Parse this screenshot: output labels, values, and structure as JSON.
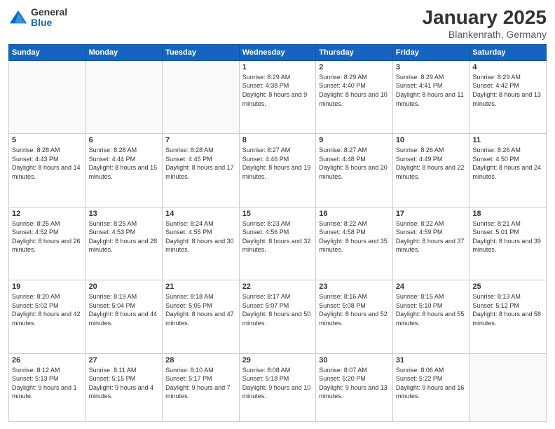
{
  "logo": {
    "general": "General",
    "blue": "Blue"
  },
  "header": {
    "title": "January 2025",
    "location": "Blankenrath, Germany"
  },
  "weekdays": [
    "Sunday",
    "Monday",
    "Tuesday",
    "Wednesday",
    "Thursday",
    "Friday",
    "Saturday"
  ],
  "weeks": [
    [
      {
        "day": "",
        "info": ""
      },
      {
        "day": "",
        "info": ""
      },
      {
        "day": "",
        "info": ""
      },
      {
        "day": "1",
        "info": "Sunrise: 8:29 AM\nSunset: 4:38 PM\nDaylight: 8 hours\nand 9 minutes."
      },
      {
        "day": "2",
        "info": "Sunrise: 8:29 AM\nSunset: 4:40 PM\nDaylight: 8 hours\nand 10 minutes."
      },
      {
        "day": "3",
        "info": "Sunrise: 8:29 AM\nSunset: 4:41 PM\nDaylight: 8 hours\nand 11 minutes."
      },
      {
        "day": "4",
        "info": "Sunrise: 8:29 AM\nSunset: 4:42 PM\nDaylight: 8 hours\nand 13 minutes."
      }
    ],
    [
      {
        "day": "5",
        "info": "Sunrise: 8:28 AM\nSunset: 4:43 PM\nDaylight: 8 hours\nand 14 minutes."
      },
      {
        "day": "6",
        "info": "Sunrise: 8:28 AM\nSunset: 4:44 PM\nDaylight: 8 hours\nand 15 minutes."
      },
      {
        "day": "7",
        "info": "Sunrise: 8:28 AM\nSunset: 4:45 PM\nDaylight: 8 hours\nand 17 minutes."
      },
      {
        "day": "8",
        "info": "Sunrise: 8:27 AM\nSunset: 4:46 PM\nDaylight: 8 hours\nand 19 minutes."
      },
      {
        "day": "9",
        "info": "Sunrise: 8:27 AM\nSunset: 4:48 PM\nDaylight: 8 hours\nand 20 minutes."
      },
      {
        "day": "10",
        "info": "Sunrise: 8:26 AM\nSunset: 4:49 PM\nDaylight: 8 hours\nand 22 minutes."
      },
      {
        "day": "11",
        "info": "Sunrise: 8:26 AM\nSunset: 4:50 PM\nDaylight: 8 hours\nand 24 minutes."
      }
    ],
    [
      {
        "day": "12",
        "info": "Sunrise: 8:25 AM\nSunset: 4:52 PM\nDaylight: 8 hours\nand 26 minutes."
      },
      {
        "day": "13",
        "info": "Sunrise: 8:25 AM\nSunset: 4:53 PM\nDaylight: 8 hours\nand 28 minutes."
      },
      {
        "day": "14",
        "info": "Sunrise: 8:24 AM\nSunset: 4:55 PM\nDaylight: 8 hours\nand 30 minutes."
      },
      {
        "day": "15",
        "info": "Sunrise: 8:23 AM\nSunset: 4:56 PM\nDaylight: 8 hours\nand 32 minutes."
      },
      {
        "day": "16",
        "info": "Sunrise: 8:22 AM\nSunset: 4:58 PM\nDaylight: 8 hours\nand 35 minutes."
      },
      {
        "day": "17",
        "info": "Sunrise: 8:22 AM\nSunset: 4:59 PM\nDaylight: 8 hours\nand 37 minutes."
      },
      {
        "day": "18",
        "info": "Sunrise: 8:21 AM\nSunset: 5:01 PM\nDaylight: 8 hours\nand 39 minutes."
      }
    ],
    [
      {
        "day": "19",
        "info": "Sunrise: 8:20 AM\nSunset: 5:02 PM\nDaylight: 8 hours\nand 42 minutes."
      },
      {
        "day": "20",
        "info": "Sunrise: 8:19 AM\nSunset: 5:04 PM\nDaylight: 8 hours\nand 44 minutes."
      },
      {
        "day": "21",
        "info": "Sunrise: 8:18 AM\nSunset: 5:05 PM\nDaylight: 8 hours\nand 47 minutes."
      },
      {
        "day": "22",
        "info": "Sunrise: 8:17 AM\nSunset: 5:07 PM\nDaylight: 8 hours\nand 50 minutes."
      },
      {
        "day": "23",
        "info": "Sunrise: 8:16 AM\nSunset: 5:08 PM\nDaylight: 8 hours\nand 52 minutes."
      },
      {
        "day": "24",
        "info": "Sunrise: 8:15 AM\nSunset: 5:10 PM\nDaylight: 8 hours\nand 55 minutes."
      },
      {
        "day": "25",
        "info": "Sunrise: 8:13 AM\nSunset: 5:12 PM\nDaylight: 8 hours\nand 58 minutes."
      }
    ],
    [
      {
        "day": "26",
        "info": "Sunrise: 8:12 AM\nSunset: 5:13 PM\nDaylight: 9 hours\nand 1 minute."
      },
      {
        "day": "27",
        "info": "Sunrise: 8:11 AM\nSunset: 5:15 PM\nDaylight: 9 hours\nand 4 minutes."
      },
      {
        "day": "28",
        "info": "Sunrise: 8:10 AM\nSunset: 5:17 PM\nDaylight: 9 hours\nand 7 minutes."
      },
      {
        "day": "29",
        "info": "Sunrise: 8:08 AM\nSunset: 5:18 PM\nDaylight: 9 hours\nand 10 minutes."
      },
      {
        "day": "30",
        "info": "Sunrise: 8:07 AM\nSunset: 5:20 PM\nDaylight: 9 hours\nand 13 minutes."
      },
      {
        "day": "31",
        "info": "Sunrise: 8:06 AM\nSunset: 5:22 PM\nDaylight: 9 hours\nand 16 minutes."
      },
      {
        "day": "",
        "info": ""
      }
    ]
  ]
}
